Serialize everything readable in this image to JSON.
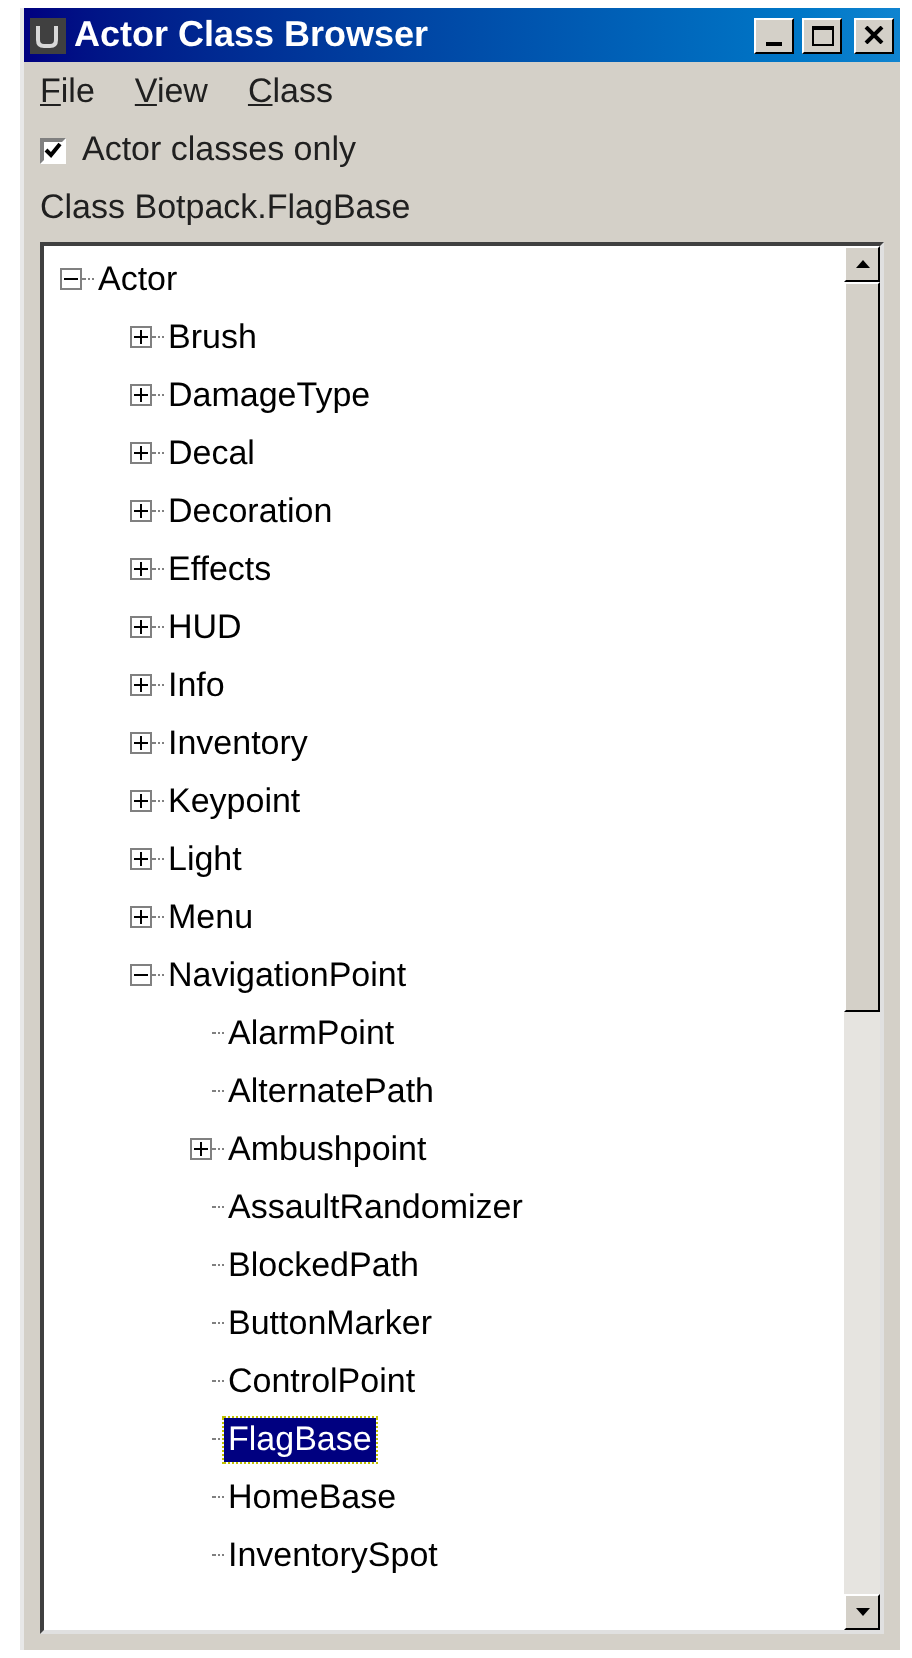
{
  "window": {
    "title": "Actor Class Browser"
  },
  "menu": [
    {
      "label": "File"
    },
    {
      "label": "View"
    },
    {
      "label": "Class"
    }
  ],
  "filter": {
    "label": "Actor classes only",
    "checked": true
  },
  "class_label": "Class Botpack.FlagBase",
  "tree": [
    {
      "label": "Actor",
      "kind": "folder",
      "expanded": true,
      "selected": false,
      "children": [
        {
          "label": "Brush",
          "kind": "folder",
          "expanded": false,
          "selected": false
        },
        {
          "label": "DamageType",
          "kind": "folder",
          "expanded": false,
          "selected": false
        },
        {
          "label": "Decal",
          "kind": "folder",
          "expanded": false,
          "selected": false
        },
        {
          "label": "Decoration",
          "kind": "folder",
          "expanded": false,
          "selected": false
        },
        {
          "label": "Effects",
          "kind": "folder",
          "expanded": false,
          "selected": false
        },
        {
          "label": "HUD",
          "kind": "folder",
          "expanded": false,
          "selected": false
        },
        {
          "label": "Info",
          "kind": "folder",
          "expanded": false,
          "selected": false
        },
        {
          "label": "Inventory",
          "kind": "folder",
          "expanded": false,
          "selected": false
        },
        {
          "label": "Keypoint",
          "kind": "folder",
          "expanded": false,
          "selected": false
        },
        {
          "label": "Light",
          "kind": "folder",
          "expanded": false,
          "selected": false
        },
        {
          "label": "Menu",
          "kind": "folder",
          "expanded": false,
          "selected": false
        },
        {
          "label": "NavigationPoint",
          "kind": "folder",
          "expanded": true,
          "selected": false,
          "children": [
            {
              "label": "AlarmPoint",
              "kind": "leaf",
              "selected": false
            },
            {
              "label": "AlternatePath",
              "kind": "leaf",
              "selected": false
            },
            {
              "label": "Ambushpoint",
              "kind": "folder",
              "expanded": false,
              "selected": false
            },
            {
              "label": "AssaultRandomizer",
              "kind": "leaf",
              "selected": false
            },
            {
              "label": "BlockedPath",
              "kind": "leaf",
              "selected": false
            },
            {
              "label": "ButtonMarker",
              "kind": "leaf",
              "selected": false
            },
            {
              "label": "ControlPoint",
              "kind": "leaf",
              "selected": false
            },
            {
              "label": "FlagBase",
              "kind": "leaf",
              "selected": true
            },
            {
              "label": "HomeBase",
              "kind": "leaf",
              "selected": false
            },
            {
              "label": "InventorySpot",
              "kind": "leaf",
              "selected": false
            }
          ]
        }
      ]
    }
  ]
}
